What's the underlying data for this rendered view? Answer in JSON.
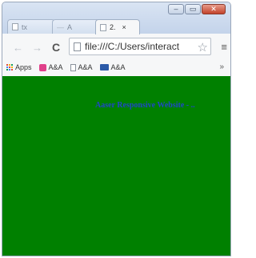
{
  "browser": {
    "tabs": [
      {
        "label": "tx",
        "active": false
      },
      {
        "label": "A",
        "active": false
      },
      {
        "label": "2.",
        "active": true
      }
    ],
    "active_tab_close": "×",
    "window_buttons": {
      "minimize": "–",
      "maximize": "▭",
      "close": "✕"
    }
  },
  "toolbar": {
    "back": "←",
    "forward": "→",
    "reload": "C",
    "url": "file:///C:/Users/interact",
    "star": "☆",
    "menu": "≡"
  },
  "bookmarks": {
    "items": [
      {
        "label": "Apps",
        "icon": "apps-grid-icon"
      },
      {
        "label": "A&A",
        "icon": "pink-favicon"
      },
      {
        "label": "A&A",
        "icon": "page-icon"
      },
      {
        "label": "A&A",
        "icon": "blue-favicon"
      }
    ],
    "overflow": "»"
  },
  "page": {
    "background": "#008000",
    "heading": "Aaser Responsive Website - ..",
    "heading_color": "#1f46c8"
  }
}
